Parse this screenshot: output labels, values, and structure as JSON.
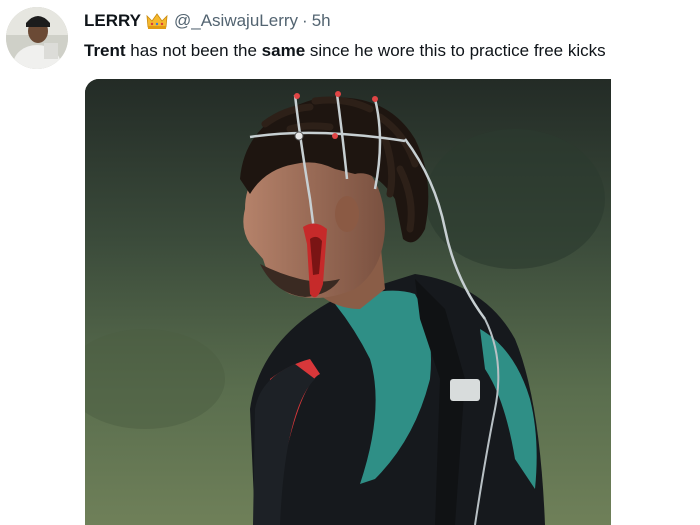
{
  "tweet": {
    "display_name": "LERRY",
    "badge_icon": "crown-emoji-icon",
    "handle": "@_AsiwajuLerry",
    "separator": "·",
    "time": "5h",
    "text_parts": [
      "Trent",
      " has not been the ",
      "same",
      " since he wore this to practice free kicks"
    ],
    "avatar_icon": "profile-avatar"
  },
  "media": {
    "description_icon": "athlete-with-sensor-headgear-photo"
  },
  "colors": {
    "text_primary": "#0f1419",
    "text_secondary": "#536471",
    "jersey_teal": "#2f8f86",
    "jersey_red": "#d8373a"
  }
}
